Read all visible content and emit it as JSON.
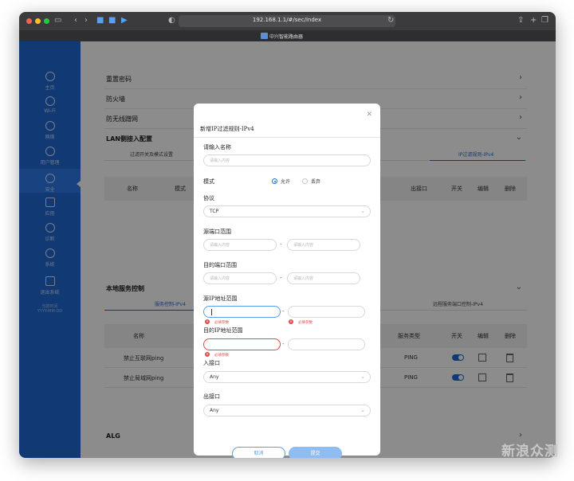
{
  "browser": {
    "url": "192.168.1.1/#/sec/index",
    "tab_title": "中兴智能路由器"
  },
  "sidebar": {
    "items": [
      {
        "label": "主页",
        "icon": "home-icon"
      },
      {
        "label": "Wi-Fi",
        "icon": "wifi-icon"
      },
      {
        "label": "网络",
        "icon": "globe-icon"
      },
      {
        "label": "用户管理",
        "icon": "users-icon"
      },
      {
        "label": "安全",
        "icon": "shield-icon"
      },
      {
        "label": "应用",
        "icon": "apps-icon"
      },
      {
        "label": "诊断",
        "icon": "diagnose-icon"
      },
      {
        "label": "系统",
        "icon": "gear-icon"
      },
      {
        "label": "退出系统",
        "icon": "logout-icon"
      }
    ],
    "footer": [
      "当前时间",
      "YYYY-MM-DD"
    ]
  },
  "main": {
    "rows": [
      "重置密码",
      "防火墙",
      "防无线蹭网"
    ],
    "lan_section": {
      "title": "LAN侧接入配置",
      "subtabs": [
        "过滤开关及模式设置",
        "IP过滤规则-IPv4"
      ],
      "columns": [
        "名称",
        "模式",
        "出接口",
        "开关",
        "编辑",
        "删除"
      ]
    },
    "local_section": {
      "title": "本地服务控制",
      "subtabs": [
        "服务控制-IPv4",
        "远程服务端口控制-IPv4"
      ],
      "columns": [
        "名称",
        "服务类型",
        "开关",
        "编辑",
        "删除"
      ],
      "rows": [
        {
          "name": "禁止互联网ping",
          "service": "PING"
        },
        {
          "name": "禁止局域网ping",
          "service": "PING"
        }
      ]
    },
    "alg_title": "ALG"
  },
  "modal": {
    "title": "新增IP过滤规则-IPv4",
    "name_label": "请输入名称",
    "name_placeholder": "请输入内容",
    "mode_label": "模式",
    "mode_allow": "允许",
    "mode_deny": "丢弃",
    "protocol_label": "协议",
    "protocol_value": "TCP",
    "src_port_label": "源端口范围",
    "dst_port_label": "目的端口范围",
    "input_placeholder": "请输入内容",
    "src_ip_label": "源IP地址范围",
    "dst_ip_label": "目的IP地址范围",
    "required_error": "必填参数",
    "in_iface_label": "入接口",
    "in_iface_value": "Any",
    "out_iface_label": "出接口",
    "out_iface_value": "Any",
    "cancel_label": "取消",
    "ok_label": "提交"
  },
  "watermark": "新浪众测"
}
